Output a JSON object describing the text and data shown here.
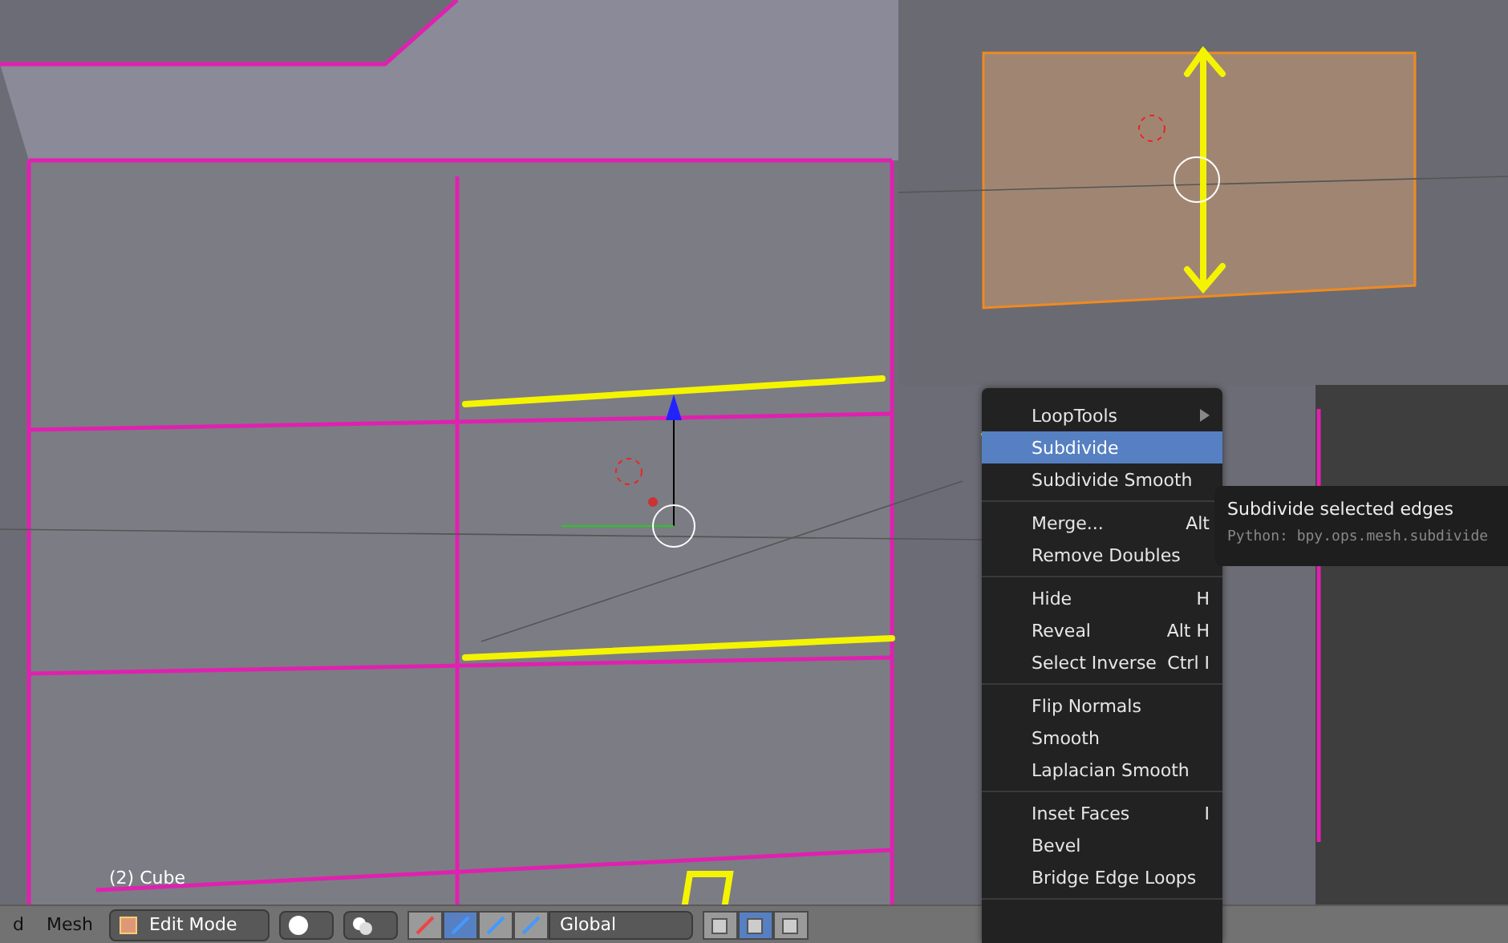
{
  "viewport": {
    "object_label": "(2) Cube"
  },
  "header": {
    "menus": [
      "d",
      "Mesh"
    ],
    "mode": "Edit Mode",
    "orientation": "Global",
    "manipulators": [
      {
        "selected": false
      },
      {
        "selected": true
      },
      {
        "selected": false
      },
      {
        "selected": false
      }
    ],
    "select_modes": [
      {
        "selected": false
      },
      {
        "selected": true
      },
      {
        "selected": false
      }
    ]
  },
  "context_menu": {
    "sections": [
      {
        "items": [
          {
            "label": "LoopTools",
            "submenu": true,
            "selected": false
          },
          {
            "label": "Subdivide",
            "submenu": false,
            "selected": true
          },
          {
            "label": "Subdivide Smooth",
            "submenu": false,
            "selected": false
          }
        ]
      },
      {
        "items": [
          {
            "label": "Merge...",
            "shortcut": "Alt",
            "submenu": false,
            "selected": false
          },
          {
            "label": "Remove Doubles",
            "submenu": false,
            "selected": false
          }
        ]
      },
      {
        "items": [
          {
            "label": "Hide",
            "shortcut": "H",
            "submenu": false,
            "selected": false
          },
          {
            "label": "Reveal",
            "shortcut": "Alt H",
            "submenu": false,
            "selected": false
          },
          {
            "label": "Select Inverse",
            "shortcut": "Ctrl I",
            "submenu": false,
            "selected": false
          }
        ]
      },
      {
        "items": [
          {
            "label": "Flip Normals",
            "submenu": false,
            "selected": false
          },
          {
            "label": "Smooth",
            "submenu": false,
            "selected": false
          },
          {
            "label": "Laplacian Smooth",
            "submenu": false,
            "selected": false
          }
        ]
      },
      {
        "items": [
          {
            "label": "Inset Faces",
            "shortcut": "I",
            "submenu": false,
            "selected": false
          },
          {
            "label": "Bevel",
            "submenu": false,
            "selected": false
          },
          {
            "label": "Bridge Edge Loops",
            "submenu": false,
            "selected": false
          }
        ]
      }
    ]
  },
  "tooltip": {
    "title": "Subdivide selected edges",
    "python": "Python: bpy.ops.mesh.subdivide"
  }
}
